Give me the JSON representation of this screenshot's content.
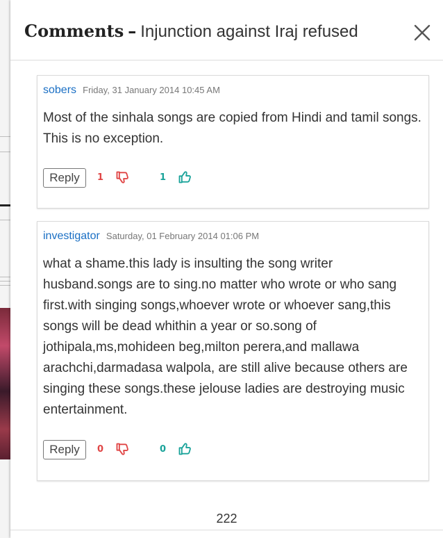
{
  "modal": {
    "title_strong": "Comments",
    "title_dash": "–",
    "title_sub": "Injunction against Iraj refused",
    "close_icon": "close-icon"
  },
  "comments": [
    {
      "author": "sobers",
      "date": "Friday, 31 January 2014 10:45 AM",
      "text": "Most of the sinhala songs are copied from Hindi and tamil songs. This is no exception.",
      "reply_label": "Reply",
      "down_votes": "1",
      "up_votes": "1"
    },
    {
      "author": "investigator",
      "date": "Saturday, 01 February 2014 01:06 PM",
      "text": "what a shame.this lady is insulting the song writer husband.songs are to sing.no matter who wrote or who sang first.with singing songs,whoever wrote or whoever sang,this songs will be dead whithin a year or so.song of jothipala,ms,mohideen beg,milton perera,and mallawa arachchi,darmadasa walpola, are still alive because others are singing these songs.these jelouse ladies are destroying music entertainment.",
      "reply_label": "Reply",
      "down_votes": "0",
      "up_votes": "0"
    }
  ],
  "pager": {
    "label": "222"
  },
  "colors": {
    "author": "#1a6fc4",
    "downvote": "#e04545",
    "upvote": "#1aa39a"
  },
  "icons": {
    "down": "thumbs-down-icon",
    "up": "thumbs-up-icon"
  }
}
